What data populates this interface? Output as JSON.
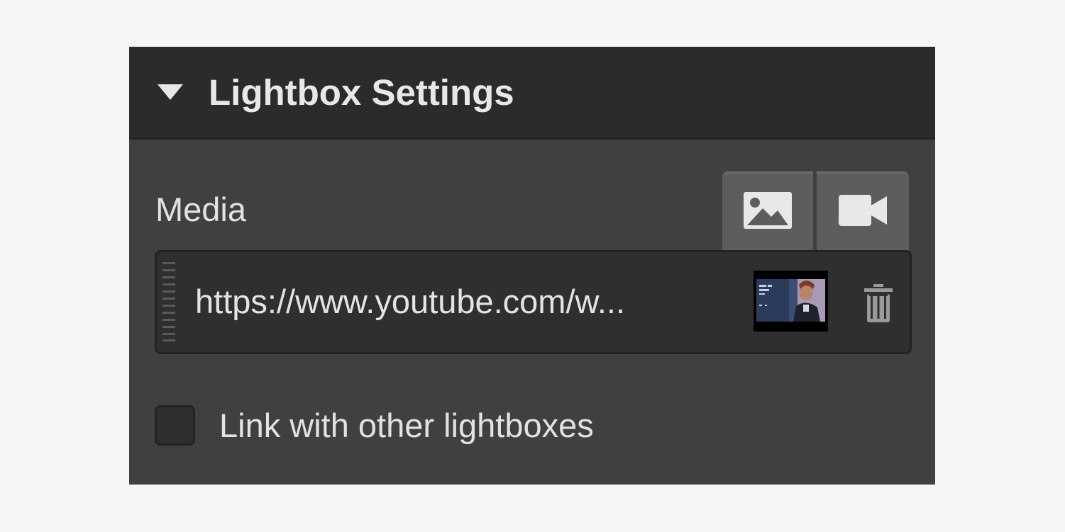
{
  "panel": {
    "title": "Lightbox Settings",
    "caret_icon": "caret-down-icon"
  },
  "media": {
    "label": "Media",
    "type_buttons": [
      {
        "icon": "image-icon",
        "active": false
      },
      {
        "icon": "video-camera-icon",
        "active": false
      }
    ],
    "url": "https://www.youtube.com/w...",
    "thumbnail_icon": "video-thumbnail",
    "delete_icon": "trash-icon",
    "drag_icon": "drag-handle-icon"
  },
  "link_option": {
    "label": "Link with other lightboxes",
    "checked": false
  },
  "colors": {
    "page_background": "#f5f6f8",
    "panel_background": "#404040",
    "header_background": "#2b2b2b",
    "field_background": "#2f2f2f",
    "button_background": "#5d5d5d",
    "text": "#e2e2e2"
  }
}
